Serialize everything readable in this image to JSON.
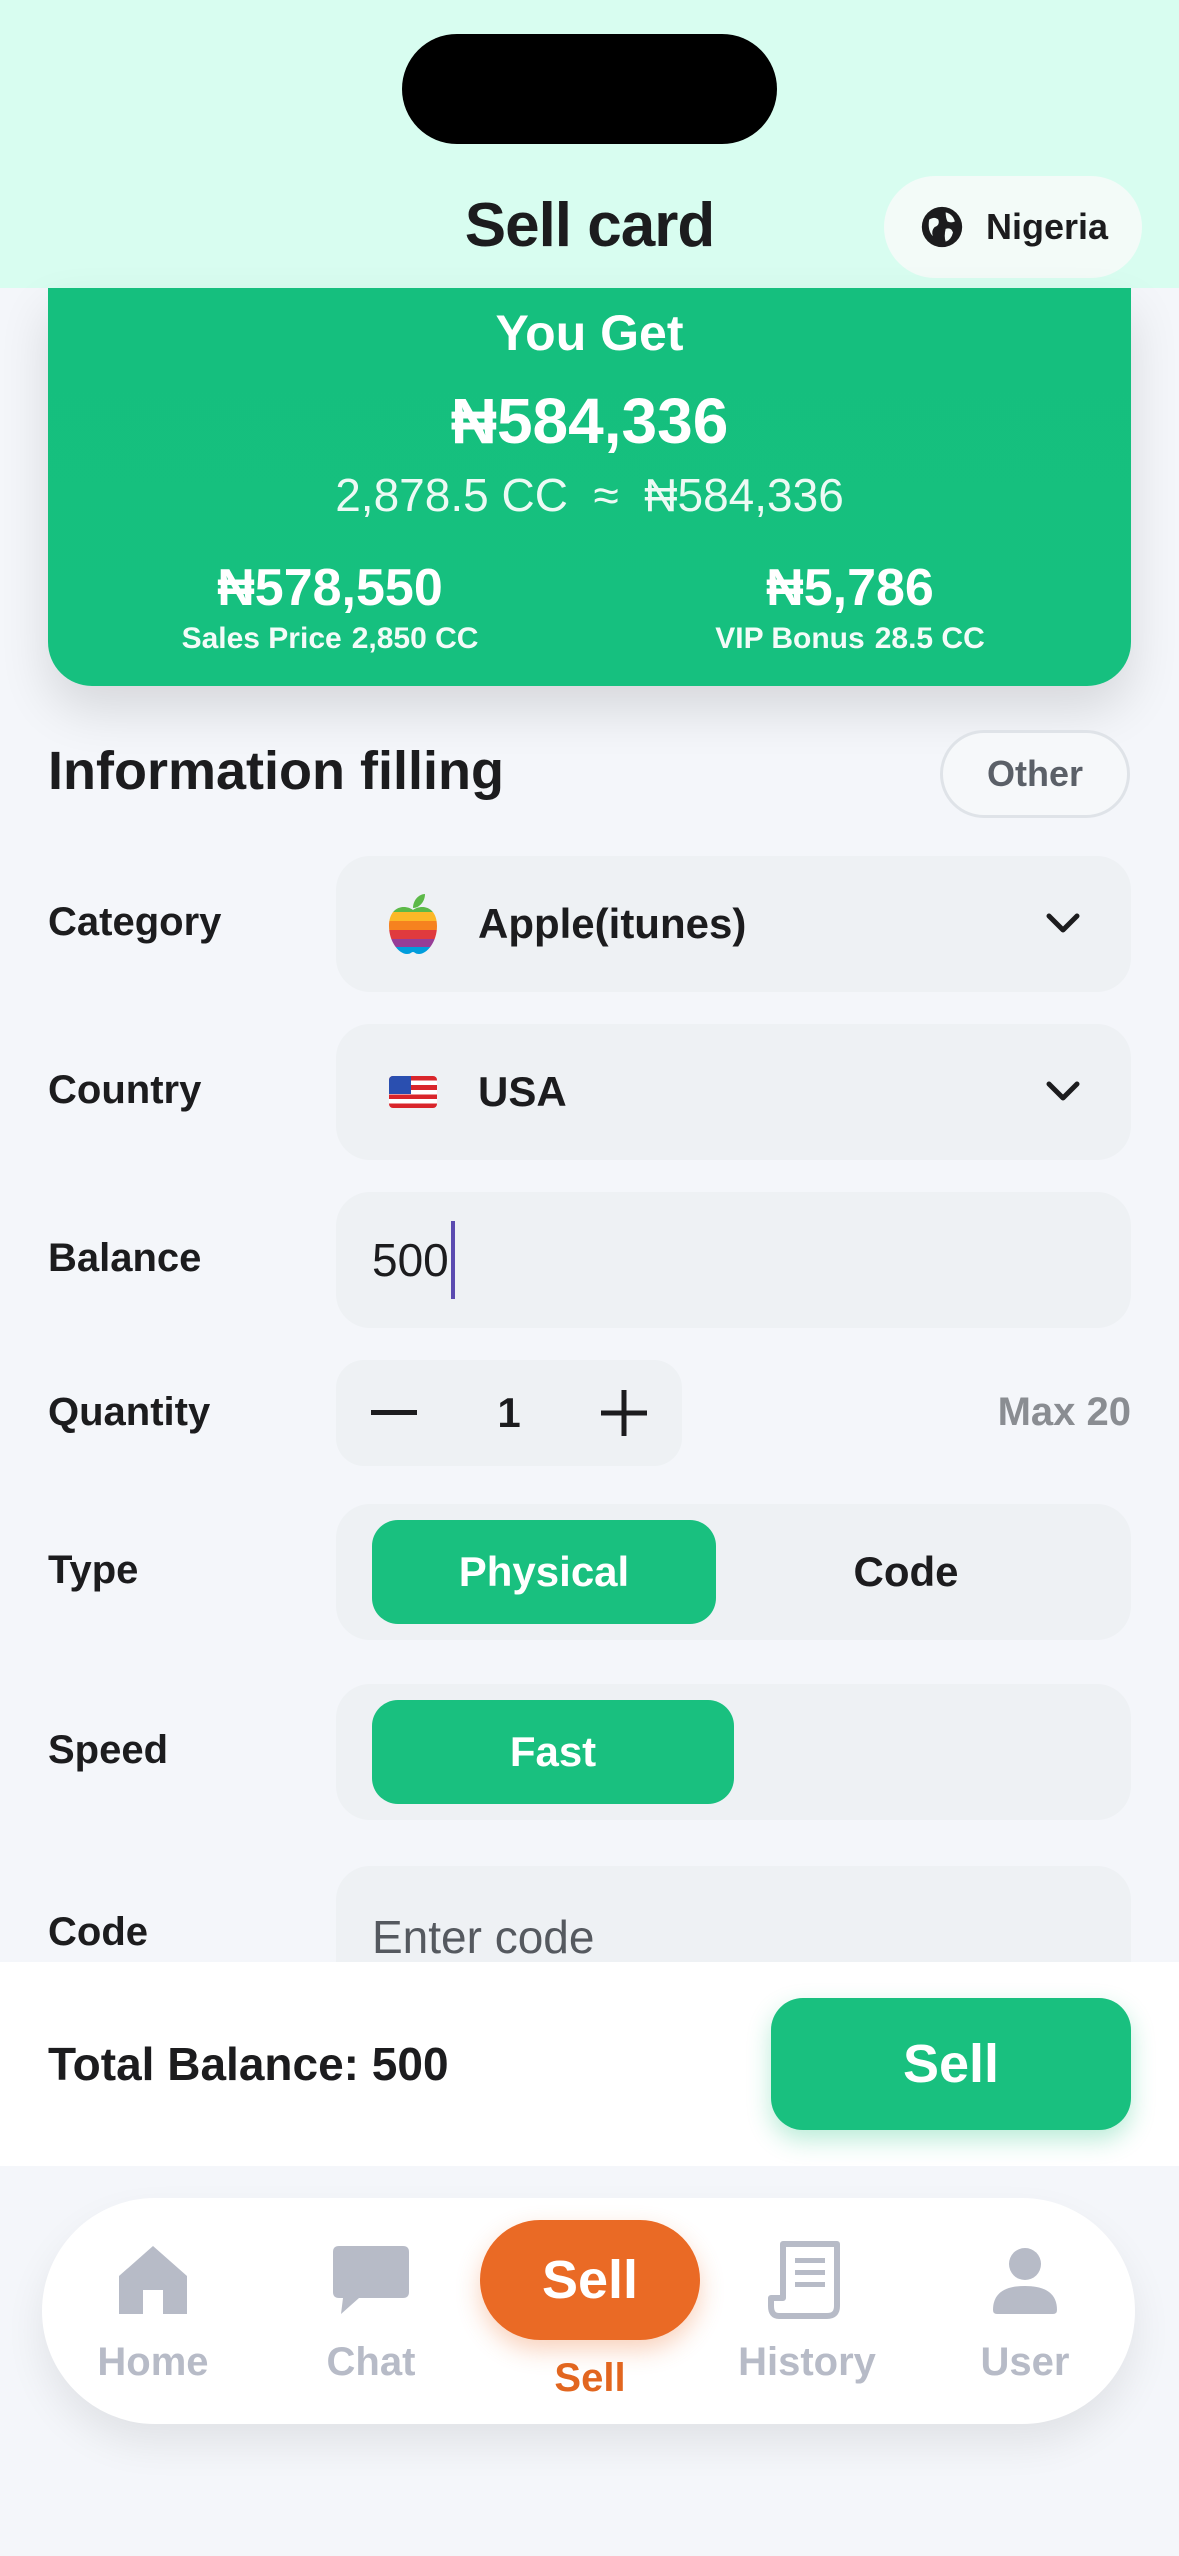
{
  "header": {
    "title": "Sell card",
    "region": "Nigeria"
  },
  "you_get": {
    "label": "You Get",
    "amount": "₦584,336",
    "conversion": "2,878.5 CC  ≈  ₦584,336",
    "sales_price_value": "₦578,550",
    "sales_price_label": "Sales Price",
    "sales_price_cc": "2,850 CC",
    "vip_bonus_value": "₦5,786",
    "vip_bonus_label": "VIP Bonus",
    "vip_bonus_cc": "28.5 CC"
  },
  "info": {
    "title": "Information filling",
    "other_label": "Other",
    "category_label": "Category",
    "category_value": "Apple(itunes)",
    "country_label": "Country",
    "country_value": "USA",
    "balance_label": "Balance",
    "balance_value": "500",
    "quantity_label": "Quantity",
    "quantity_value": "1",
    "max_label": "Max 20",
    "type_label": "Type",
    "type_options": [
      "Physical",
      "Code"
    ],
    "type_selected": "Physical",
    "speed_label": "Speed",
    "speed_options": [
      "Fast"
    ],
    "code_label": "Code",
    "code_placeholder": "Enter code"
  },
  "footer": {
    "total": "Total Balance: 500",
    "sell_label": "Sell"
  },
  "tabbar": {
    "items": [
      {
        "label": "Home",
        "icon": "home-icon"
      },
      {
        "label": "Chat",
        "icon": "chat-icon"
      },
      {
        "label": "Sell",
        "icon": "sell-pill",
        "pill": "Sell"
      },
      {
        "label": "History",
        "icon": "history-icon"
      },
      {
        "label": "User",
        "icon": "user-icon"
      }
    ],
    "active": "Sell"
  },
  "colors": {
    "accent": "#19c07f",
    "header_bg": "#d8fdf0",
    "sell_tab": "#ea6a25",
    "inactive_tab": "#b7bbc7"
  }
}
